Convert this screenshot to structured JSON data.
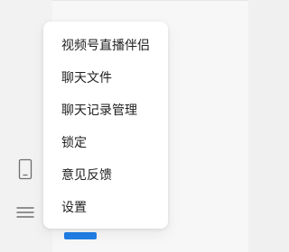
{
  "dropdown_menu": {
    "items": [
      {
        "label": "视频号直播伴侣"
      },
      {
        "label": "聊天文件"
      },
      {
        "label": "聊天记录管理"
      },
      {
        "label": "锁定"
      },
      {
        "label": "意见反馈"
      },
      {
        "label": "设置"
      }
    ]
  },
  "sidebar": {
    "phone_icon": "phone-icon",
    "menu_icon": "hamburger-menu-icon"
  },
  "colors": {
    "accent_blue": "#1f7ee6",
    "menu_background": "#ffffff",
    "sidebar_background": "#f2f2f2",
    "main_background": "#f7f7f7"
  }
}
